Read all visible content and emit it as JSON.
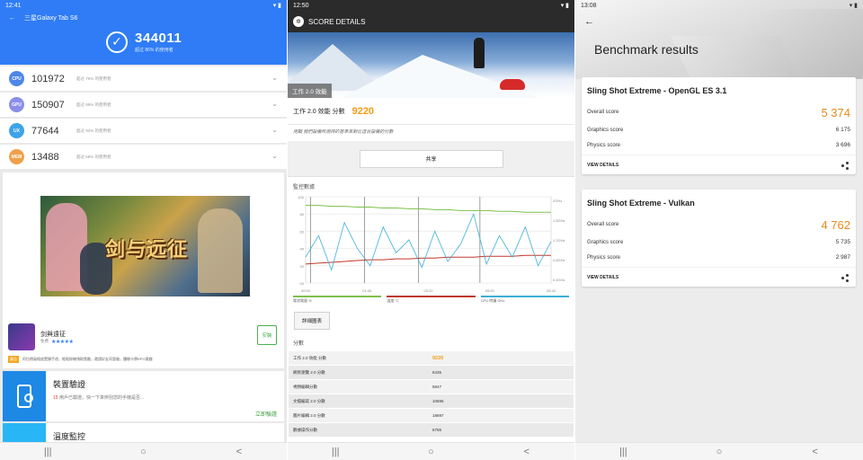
{
  "antutu": {
    "status_time": "12:41",
    "device": "三星Galaxy Tab S6",
    "total_score": "344011",
    "total_sub": "超过 86% 的使用者",
    "rows": [
      {
        "badge": "CPU",
        "color": "#4e87e8",
        "value": "101972",
        "sub": "超过 76% 的使用者"
      },
      {
        "badge": "GPU",
        "color": "#8a8ee8",
        "value": "150907",
        "sub": "超过 89% 的使用者"
      },
      {
        "badge": "UX",
        "color": "#3ea3e8",
        "value": "77644",
        "sub": "超过 94% 的使用者"
      },
      {
        "badge": "MEM",
        "color": "#f0a04a",
        "value": "13488",
        "sub": "超过 68% 的使用者"
      }
    ],
    "ad": {
      "banner_title": "剑与远征",
      "app_name": "剑與遠征",
      "app_sub": "免费",
      "rating": 4.5,
      "install_label": "安裝",
      "ad_tag": "廣告",
      "ad_text": "阿拉德風格放置類手遊，輕鬆掛機領取獎勵，邀請好友同冒險，體驗卡牌RPG樂趣"
    },
    "tool1": {
      "title": "裝置驗證",
      "count": "15",
      "sub": "用戶已驗證，快一下來辨別您的手機是否...",
      "link": "立即驗證"
    },
    "tool2": {
      "title": "溫度監控"
    }
  },
  "pcmark": {
    "status_time": "12:50",
    "bar_title": "SCORE DETAILS",
    "hero_label": "工作 2.0 效能",
    "hero_sub": "2.0",
    "score_label": "工作 2.0 效能 分數",
    "score_value": "9220",
    "note": "用戰 我們設備所測得的基準來對比這台設備的分數",
    "share_label": "共享",
    "monitor_title": "監控數據",
    "legend": [
      {
        "label": "電池電量 %",
        "color": "#7cc14a"
      },
      {
        "label": "溫度 °C",
        "color": "#c0392b"
      },
      {
        "label": "CPU 時鐘 GHz",
        "color": "#3bb0d6"
      }
    ],
    "detail_button": "詳細圖表",
    "table_title": "分數",
    "table": [
      {
        "k": "工作 2.0 效能 分數",
        "v": "9220",
        "hl": true
      },
      {
        "k": "網頁瀏覽 2.0 分數",
        "v": "8435"
      },
      {
        "k": "視頻編輯分數",
        "v": "5847"
      },
      {
        "k": "文檔編寫 2.0 分數",
        "v": "10696"
      },
      {
        "k": "圖片編輯 2.0 分數",
        "v": "18697"
      },
      {
        "k": "數據操作分數",
        "v": "6755"
      }
    ]
  },
  "chart_data": {
    "type": "line",
    "title": "",
    "y_left_ticks": [
      "100",
      "80",
      "60",
      "40",
      "20",
      "00"
    ],
    "y_right_ticks": [
      "2GHz",
      "1.6GHz",
      "1.2GHz",
      "0.8GHz",
      "0.4GHz"
    ],
    "x_ticks": [
      "00:00",
      "01:40",
      "03:20",
      "05:00",
      "06:40"
    ],
    "ylim": [
      0,
      100
    ],
    "series": [
      {
        "color": "#7cc14a",
        "values": [
          90,
          90,
          89,
          89,
          88,
          88,
          87,
          87,
          86,
          86,
          85,
          85,
          84,
          84,
          84,
          83,
          83,
          82,
          82,
          82
        ]
      },
      {
        "color": "#c0392b",
        "values": [
          22,
          23,
          24,
          25,
          26,
          27,
          27,
          28,
          28,
          29,
          29,
          30,
          30,
          30,
          31,
          31,
          31,
          32,
          32,
          32
        ]
      },
      {
        "color": "#3bb0d6",
        "values": [
          30,
          55,
          15,
          70,
          40,
          20,
          65,
          35,
          50,
          18,
          60,
          25,
          45,
          80,
          22,
          55,
          30,
          65,
          20,
          48
        ]
      }
    ]
  },
  "threedmark": {
    "status_time": "13:08",
    "title": "Benchmark results",
    "cards": [
      {
        "title": "Sling Shot Extreme - OpenGL ES 3.1",
        "overall_label": "Overall score",
        "overall": "5 374",
        "graphics_label": "Graphics score",
        "graphics": "6 175",
        "physics_label": "Physics score",
        "physics": "3 696",
        "view": "VIEW DETAILS"
      },
      {
        "title": "Sling Shot Extreme - Vulkan",
        "overall_label": "Overall score",
        "overall": "4 762",
        "graphics_label": "Graphics score",
        "graphics": "5 735",
        "physics_label": "Physics score",
        "physics": "2 987",
        "view": "VIEW DETAILS"
      }
    ]
  },
  "nav": {
    "recents": "|||",
    "home": "○",
    "back": "<"
  }
}
